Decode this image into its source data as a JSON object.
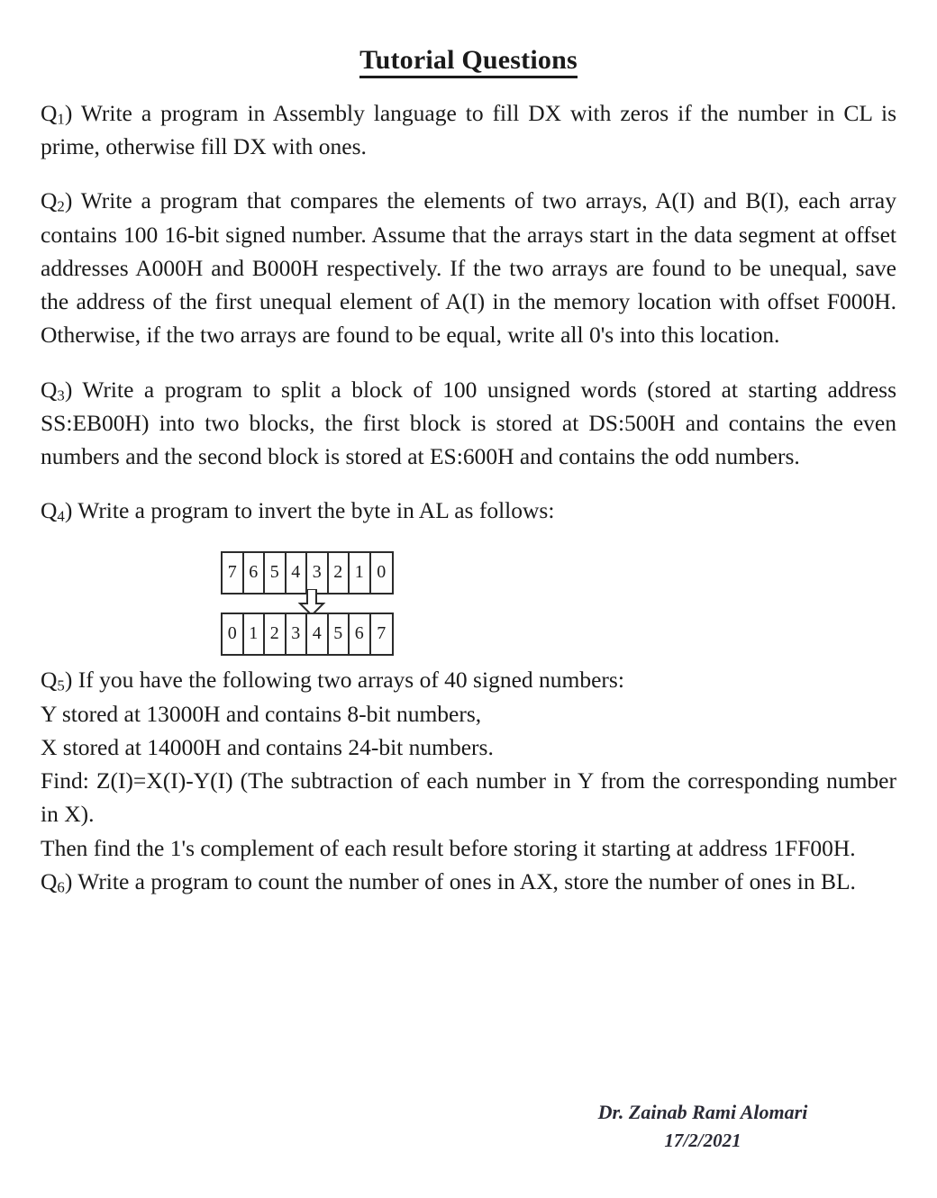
{
  "document": {
    "title": "Tutorial Questions"
  },
  "questions": [
    {
      "id": "q1",
      "label_q": "Q",
      "label_num": "1",
      "label_paren": ")",
      "text": "Write a program in Assembly language to fill DX with zeros if the number in CL is prime, otherwise fill DX with ones."
    },
    {
      "id": "q2",
      "label_q": "Q",
      "label_num": "2",
      "label_paren": ")",
      "text": "Write a program that compares the elements of two arrays, A(I) and B(I), each array contains 100 16-bit signed number. Assume that the arrays start in the data segment at offset addresses A000H and B000H respectively. If the two arrays are found to be unequal, save the address of the first unequal element of A(I) in the memory location with offset F000H. Otherwise, if the two arrays are found to be equal, write all 0's into this location."
    },
    {
      "id": "q3",
      "label_q": "Q",
      "label_num": "3",
      "label_paren": ")",
      "text": "Write a program to split a block of 100 unsigned words (stored at starting address SS:EB00H) into two blocks, the first block is stored at DS:500H and contains the even numbers and the second block is stored at ES:600H and contains the odd numbers."
    },
    {
      "id": "q4",
      "label_q": "Q",
      "label_num": "4",
      "label_paren": ")",
      "text": "Write a program to invert the byte in AL as follows:"
    }
  ],
  "bit_diagram": {
    "top_row": [
      "7",
      "6",
      "5",
      "4",
      "3",
      "2",
      "1",
      "0"
    ],
    "bottom_row": [
      "0",
      "1",
      "2",
      "3",
      "4",
      "5",
      "6",
      "7"
    ],
    "arrow_direction": "down"
  },
  "q5": {
    "label_q": "Q",
    "label_num": "5",
    "label_paren": ")",
    "line1": "If you have the following two arrays of 40 signed numbers:",
    "line2": "Y stored at 13000H  and contains 8-bit numbers,",
    "line3": "X stored at 14000H  and contains 24-bit numbers.",
    "line4": "Find: Z(I)=X(I)-Y(I) (The subtraction of each number in Y from the corresponding number in X).",
    "line5": "Then find the 1's complement of each result before storing it starting at address 1FF00H."
  },
  "q6": {
    "label_q": "Q",
    "label_num": "6",
    "label_paren": ")",
    "text": "Write a program to count the number of ones in AX, store the number of ones in BL."
  },
  "signature": {
    "name": "Dr. Zainab Rami Alomari",
    "date": "17/2/2021"
  },
  "colors": {
    "text": "#1a1a1a",
    "rule": "#2b2b2b",
    "signature": "#2a2a35",
    "background": "#ffffff"
  }
}
